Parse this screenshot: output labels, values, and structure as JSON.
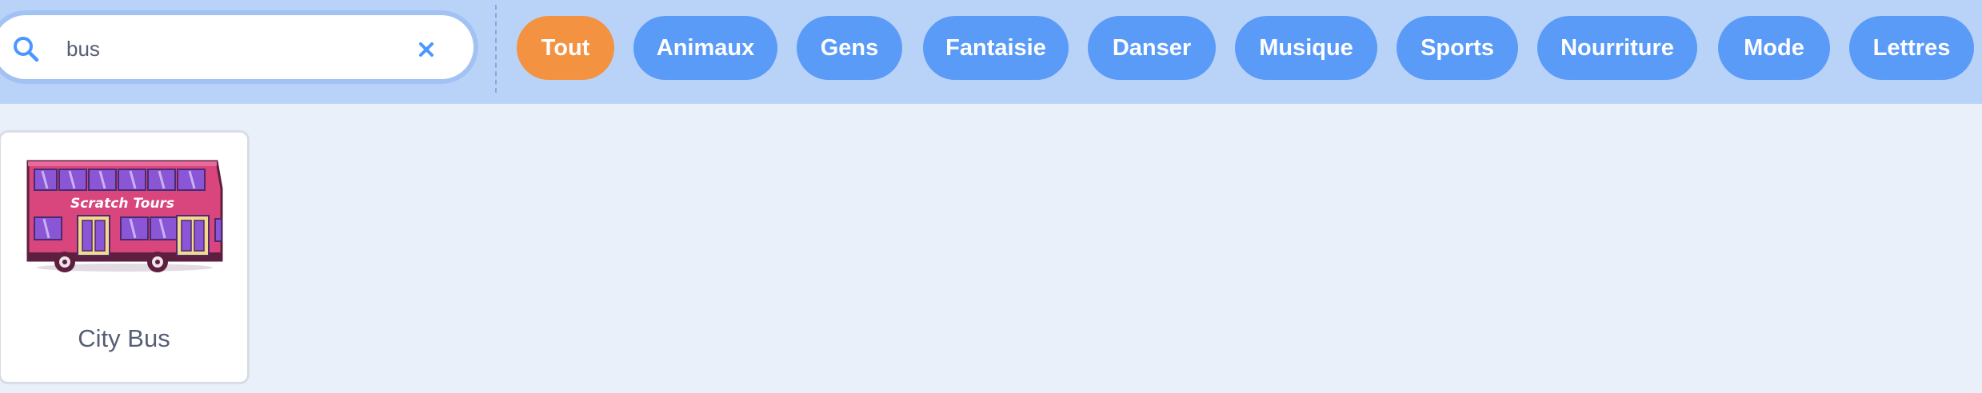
{
  "search": {
    "value": "bus",
    "icon": "search-icon",
    "clear_icon": "close-icon"
  },
  "categories": [
    {
      "label": "Tout",
      "active": true
    },
    {
      "label": "Animaux",
      "active": false
    },
    {
      "label": "Gens",
      "active": false
    },
    {
      "label": "Fantaisie",
      "active": false
    },
    {
      "label": "Danser",
      "active": false
    },
    {
      "label": "Musique",
      "active": false
    },
    {
      "label": "Sports",
      "active": false
    },
    {
      "label": "Nourriture",
      "active": false
    },
    {
      "label": "Mode",
      "active": false
    },
    {
      "label": "Lettres",
      "active": false
    }
  ],
  "results": [
    {
      "name": "City Bus",
      "image_text": "Scratch Tours"
    }
  ],
  "colors": {
    "accent_active": "#f39240",
    "tag": "#5a9bf7",
    "bar": "#b9d3f8",
    "bus_body": "#d9457d"
  }
}
